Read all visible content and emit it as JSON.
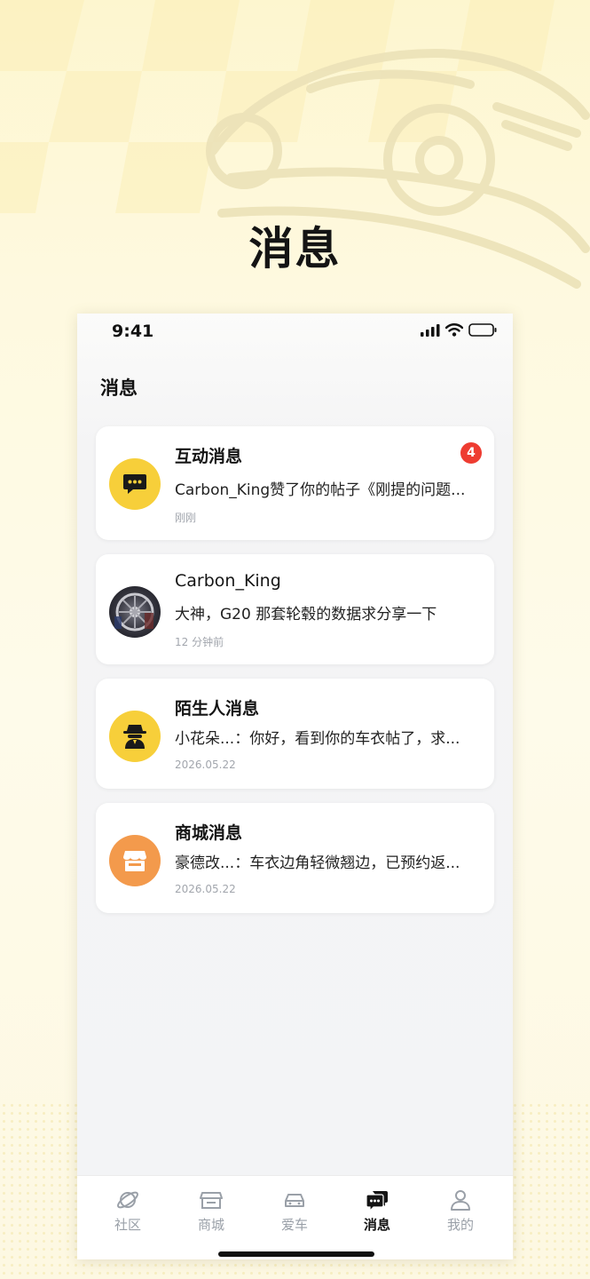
{
  "hero": {
    "title": "消息"
  },
  "status_bar": {
    "time": "9:41"
  },
  "header": {
    "title": "消息"
  },
  "messages": [
    {
      "title": "互动消息",
      "preview": "Carbon_King赞了你的帖子《刚提的问题...",
      "time": "刚刚",
      "badge": "4",
      "avatar_icon": "chat-bubble-icon",
      "avatar_color": "#f7cf3a"
    },
    {
      "title": "Carbon_King",
      "preview": "大神，G20 那套轮毂的数据求分享一下",
      "time": "12 分钟前",
      "avatar_icon": "user-photo-avatar"
    },
    {
      "title": "陌生人消息",
      "preview": "小花朵...：你好，看到你的车衣帖了，求...",
      "time": "2026.05.22",
      "avatar_icon": "spy-icon",
      "avatar_color": "#f7cf3a"
    },
    {
      "title": "商城消息",
      "preview": "豪德改...：车衣边角轻微翘边，已预约返...",
      "time": "2026.05.22",
      "avatar_icon": "store-icon",
      "avatar_color": "#f39a4c"
    }
  ],
  "tabbar": {
    "items": [
      {
        "label": "社区",
        "icon": "planet-icon",
        "active": false
      },
      {
        "label": "商城",
        "icon": "store-icon",
        "active": false
      },
      {
        "label": "爱车",
        "icon": "car-icon",
        "active": false
      },
      {
        "label": "消息",
        "icon": "chat-icon",
        "active": true
      },
      {
        "label": "我的",
        "icon": "person-icon",
        "active": false
      }
    ]
  },
  "colors": {
    "accent_yellow": "#f7cf3a",
    "accent_orange": "#f39a4c",
    "badge_red": "#ee3c31",
    "inactive_tab": "#9aa0a8"
  }
}
